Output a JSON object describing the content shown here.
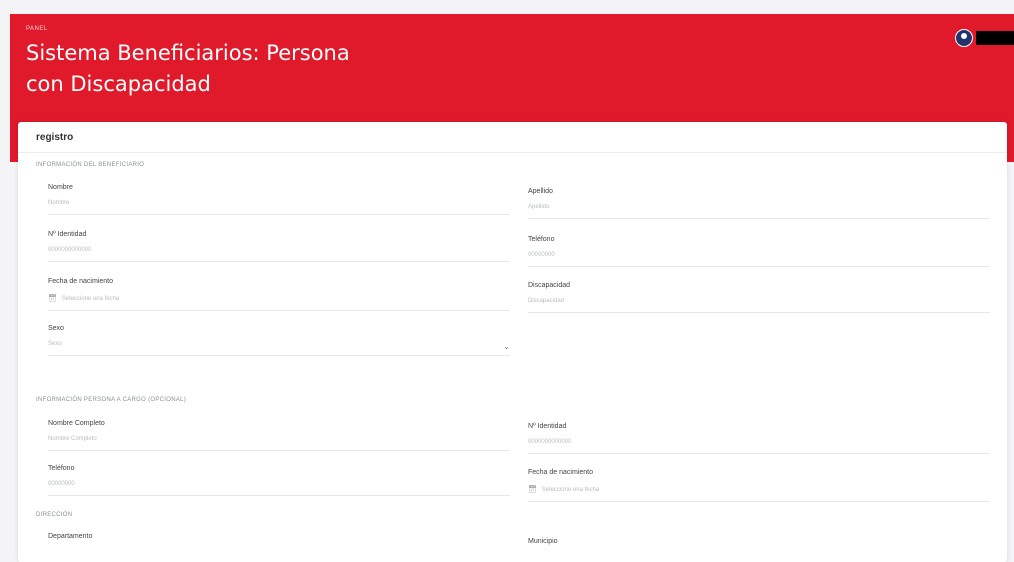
{
  "header": {
    "panel_label": "PANEL",
    "title": "Sistema Beneficiarios: Persona con Discapacidad"
  },
  "card": {
    "title": "registro"
  },
  "beneficiario": {
    "section_title": "INFORMACIÓN DEL BENEFICIARIO",
    "nombre": {
      "label": "Nombre",
      "placeholder": "Nombre"
    },
    "apellido": {
      "label": "Apellido",
      "placeholder": "Apellido"
    },
    "identidad": {
      "label": "Nº Identidad",
      "placeholder": "0000000000000"
    },
    "telefono": {
      "label": "Teléfono",
      "placeholder": "00000000"
    },
    "nacimiento": {
      "label": "Fecha de nacimiento",
      "placeholder": "Seleccione una fecha"
    },
    "discapacidad": {
      "label": "Discapacidad",
      "placeholder": "Discapacidad"
    },
    "sexo": {
      "label": "Sexo",
      "value": "Sexo"
    }
  },
  "encargado": {
    "section_title": "INFORMACIÓN PERSONA A CARGO (OPCIONAL)",
    "nombre": {
      "label": "Nombre Completo",
      "placeholder": "Nombre Completo"
    },
    "identidad": {
      "label": "Nº Identidad",
      "placeholder": "0000000000000"
    },
    "telefono": {
      "label": "Teléfono",
      "placeholder": "00000000"
    },
    "nacimiento": {
      "label": "Fecha de nacimiento",
      "placeholder": "Seleccione una fecha"
    }
  },
  "direccion": {
    "section_title": "DIRECCIÓN",
    "departamento": {
      "label": "Departamento"
    },
    "municipio": {
      "label": "Municipio"
    }
  },
  "colors": {
    "banner": "#e0192b",
    "avatar": "#23336b"
  },
  "icons": {
    "calendar": "calendar-icon",
    "chevron": "chevron-down-icon",
    "avatar": "user-avatar-icon"
  }
}
